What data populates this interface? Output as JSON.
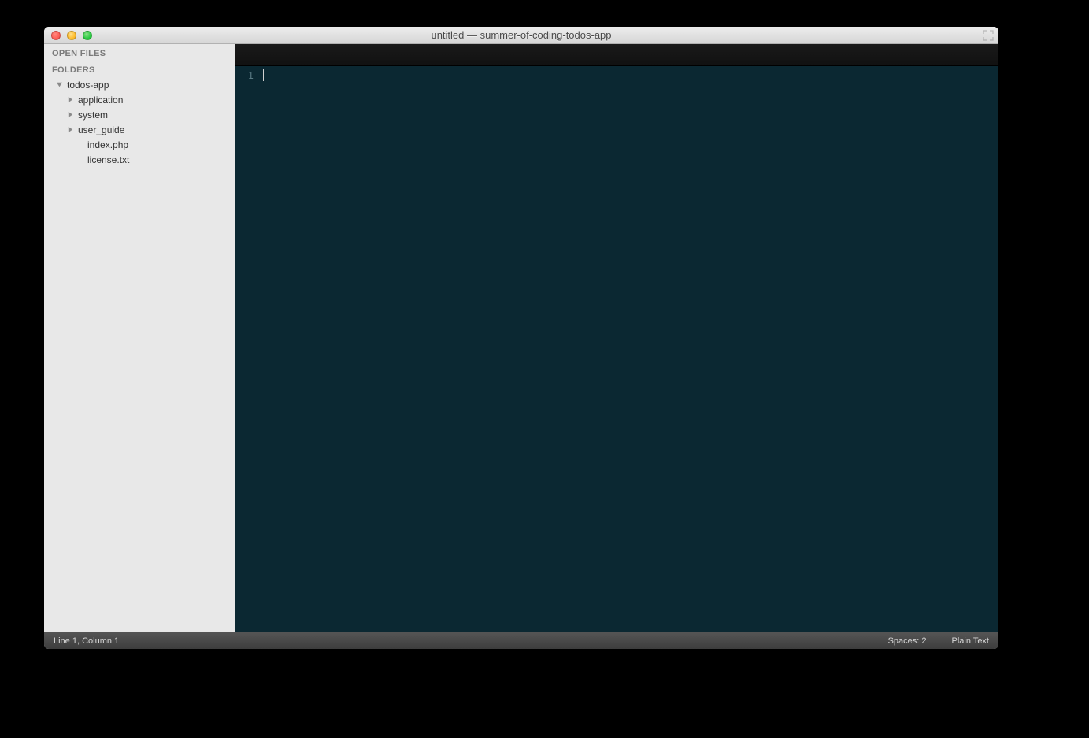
{
  "window": {
    "title": "untitled — summer-of-coding-todos-app"
  },
  "sidebar": {
    "open_files_label": "OPEN FILES",
    "folders_label": "FOLDERS",
    "root": {
      "name": "todos-app",
      "children": [
        {
          "name": "application",
          "type": "folder"
        },
        {
          "name": "system",
          "type": "folder"
        },
        {
          "name": "user_guide",
          "type": "folder"
        },
        {
          "name": "index.php",
          "type": "file"
        },
        {
          "name": "license.txt",
          "type": "file"
        }
      ]
    }
  },
  "editor": {
    "line_numbers": [
      "1"
    ]
  },
  "statusbar": {
    "position": "Line 1, Column 1",
    "indent": "Spaces: 2",
    "syntax": "Plain Text"
  }
}
